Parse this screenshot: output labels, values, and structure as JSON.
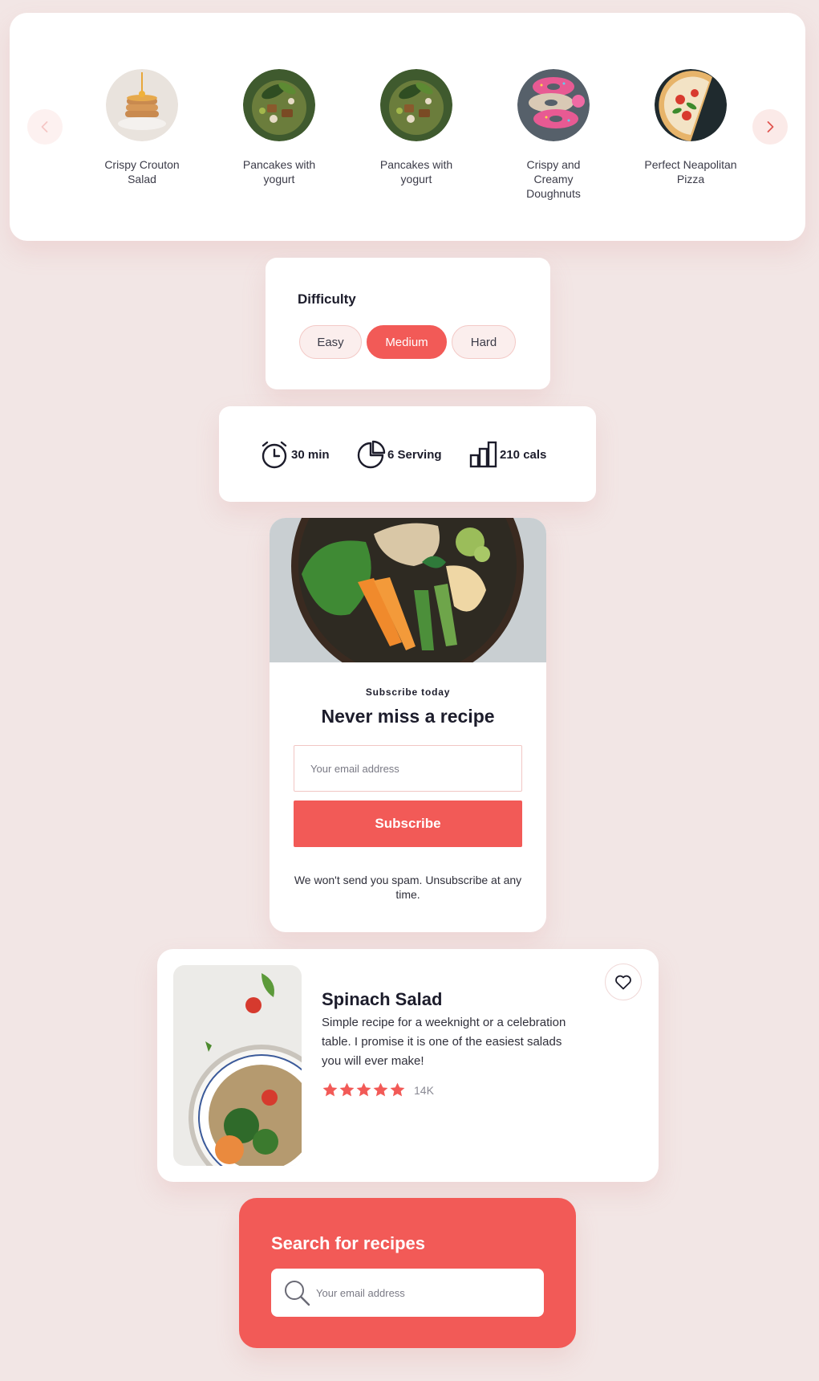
{
  "carousel": {
    "items": [
      {
        "name": "Crispy Crouton Salad",
        "image": "pancakes-photo"
      },
      {
        "name": "Pancakes with yogurt",
        "image": "bowl-photo"
      },
      {
        "name": "Pancakes with yogurt",
        "image": "bowl-photo"
      },
      {
        "name": "Crispy and Creamy Doughnuts",
        "image": "doughnuts-photo"
      },
      {
        "name": "Perfect Neapolitan Pizza",
        "image": "pizza-photo"
      }
    ],
    "prev_icon": "chevron-left-icon",
    "next_icon": "chevron-right-icon"
  },
  "difficulty": {
    "title": "Difficulty",
    "options": [
      "Easy",
      "Medium",
      "Hard"
    ],
    "selected": "Medium"
  },
  "stats": {
    "time": "30 min",
    "servings": "6 Serving",
    "calories": "210 cals",
    "icons": [
      "alarm-clock-icon",
      "pie-chart-icon",
      "bar-chart-icon"
    ]
  },
  "subscribe": {
    "kicker": "Subscribe today",
    "title": "Never miss a recipe",
    "email_placeholder": "Your email address",
    "button": "Subscribe",
    "note": "We won't send you spam. Unsubscribe at any time."
  },
  "recipe_card": {
    "title": "Spinach Salad",
    "description": "Simple recipe for a weeknight or a celebration table. I promise it is one of the easiest salads you will ever make!",
    "rating": 5,
    "reviews": "14K",
    "favorite_icon": "heart-icon"
  },
  "search": {
    "title": "Search for recipes",
    "placeholder": "Your email address",
    "icon": "search-icon"
  },
  "colors": {
    "accent": "#f25a57",
    "background": "#f2e6e5",
    "pill_bg": "#fbeeed",
    "text": "#1c1c2b"
  }
}
